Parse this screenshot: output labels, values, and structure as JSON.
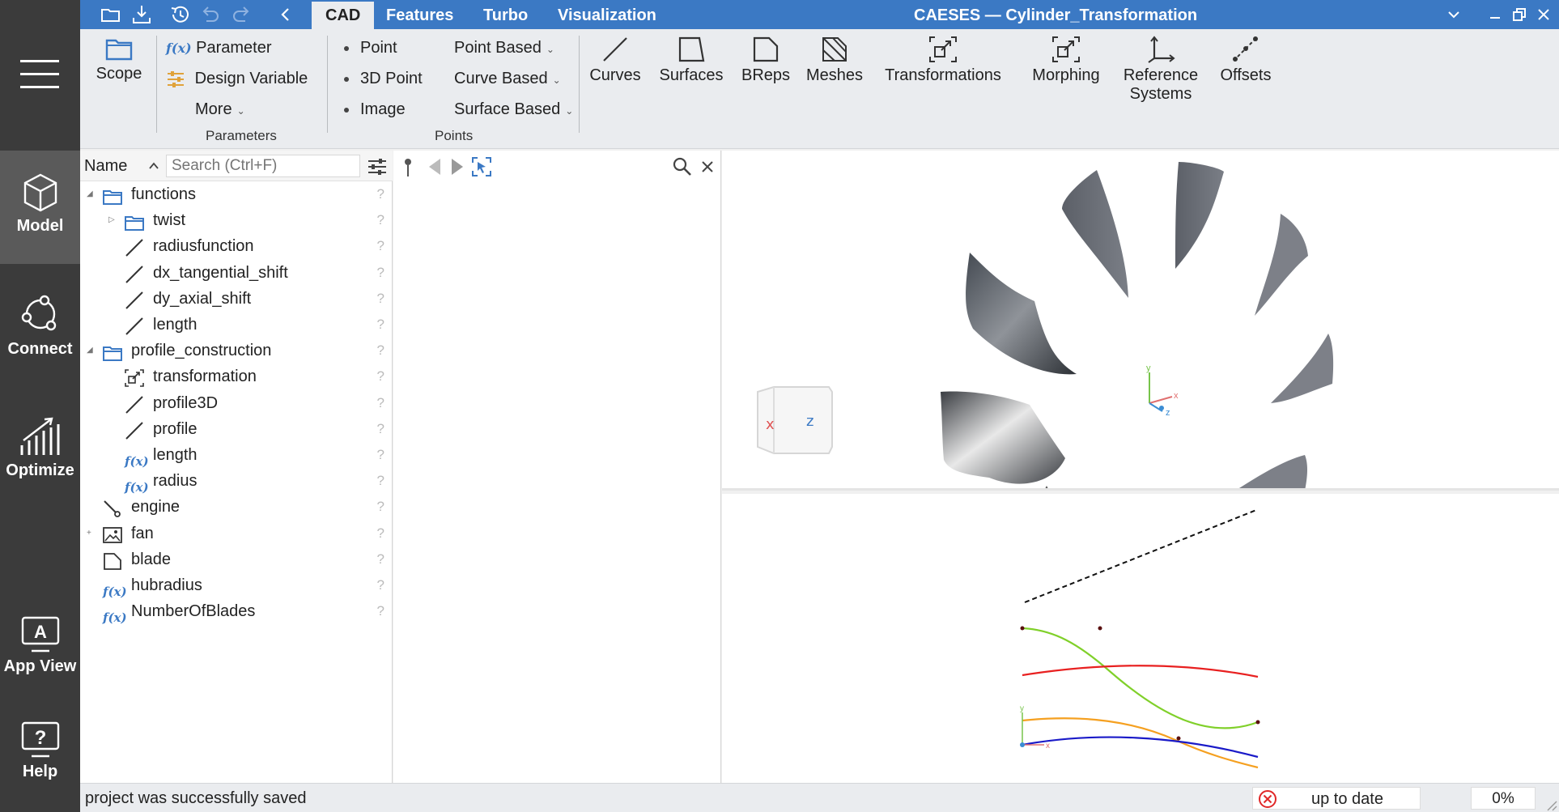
{
  "window": {
    "title": "CAESES — Cylinder_Transformation"
  },
  "tabs": [
    {
      "label": "CAD",
      "active": true
    },
    {
      "label": "Features"
    },
    {
      "label": "Turbo"
    },
    {
      "label": "Visualization"
    }
  ],
  "leftbar": {
    "items": [
      {
        "label": "Model",
        "icon": "cube-icon",
        "active": true
      },
      {
        "label": "Connect",
        "icon": "connect-icon"
      },
      {
        "label": "Optimize",
        "icon": "optimize-icon"
      },
      {
        "label": "App View",
        "icon": "app-view-icon"
      },
      {
        "label": "Help",
        "icon": "help-icon"
      }
    ]
  },
  "ribbon": {
    "scope": "Scope",
    "parameter": "Parameter",
    "design_variable": "Design Variable",
    "more": "More",
    "group_parameters": "Parameters",
    "point": "Point",
    "point_3d": "3D Point",
    "image": "Image",
    "point_based": "Point Based",
    "curve_based": "Curve Based",
    "surface_based": "Surface Based",
    "group_points": "Points",
    "curves": "Curves",
    "surfaces": "Surfaces",
    "breps": "BReps",
    "meshes": "Meshes",
    "transformations": "Transformations",
    "morphing": "Morphing",
    "reference": "Reference",
    "systems": "Systems",
    "offsets": "Offsets"
  },
  "tree": {
    "header": {
      "name": "Name",
      "search_placeholder": "Search (Ctrl+F)"
    },
    "rows": [
      {
        "label": "functions",
        "icon": "folder-icon",
        "q": "?"
      },
      {
        "label": "twist",
        "icon": "folder-icon",
        "q": "?"
      },
      {
        "label": "radiusfunction",
        "icon": "curve-icon",
        "q": "?"
      },
      {
        "label": "dx_tangential_shift",
        "icon": "curve-icon",
        "q": "?"
      },
      {
        "label": "dy_axial_shift",
        "icon": "curve-icon",
        "q": "?"
      },
      {
        "label": "length",
        "icon": "curve-icon",
        "q": "?"
      },
      {
        "label": "profile_construction",
        "icon": "folder-icon",
        "q": "?"
      },
      {
        "label": "transformation",
        "icon": "transformation-icon",
        "q": "?"
      },
      {
        "label": "profile3D",
        "icon": "curve-icon",
        "q": "?"
      },
      {
        "label": "profile",
        "icon": "curve-icon",
        "q": "?"
      },
      {
        "label": "length",
        "icon": "fx-icon",
        "q": "?"
      },
      {
        "label": "radius",
        "icon": "fx-icon",
        "q": "?"
      },
      {
        "label": "engine",
        "icon": "engine-icon",
        "q": "?"
      },
      {
        "label": "fan",
        "icon": "image-icon",
        "q": "?"
      },
      {
        "label": "blade",
        "icon": "surface-icon",
        "q": "?"
      },
      {
        "label": "hubradius",
        "icon": "fx-icon",
        "q": "?"
      },
      {
        "label": "NumberOfBlades",
        "icon": "fx-icon",
        "q": "?"
      }
    ]
  },
  "viewport": {
    "cube_x": "x",
    "cube_z": "z",
    "axis_y": "y",
    "axis_x": "x",
    "axis_z": "z"
  },
  "status": {
    "message": "project was successfully saved",
    "state": "up to date",
    "progress": "0%"
  }
}
